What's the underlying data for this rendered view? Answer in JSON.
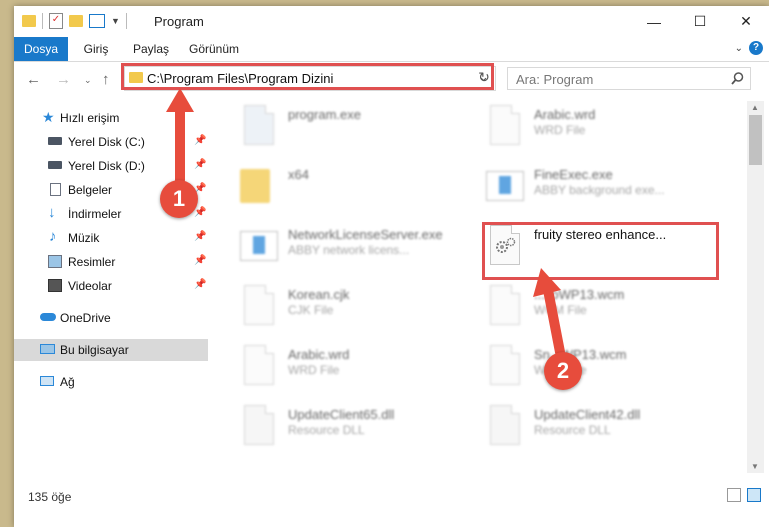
{
  "window": {
    "title": "Program"
  },
  "window_buttons": {
    "minimize": "—",
    "maximize": "☐",
    "close": "✕"
  },
  "ribbon": {
    "tabs": [
      "Dosya",
      "Giriş",
      "Paylaş",
      "Görünüm"
    ],
    "help": "?"
  },
  "address": {
    "path": "C:\\Program Files\\Program Dizini",
    "refresh": "↻",
    "dropdown": "⌄"
  },
  "search": {
    "placeholder": "Ara: Program",
    "icon": "search-icon"
  },
  "sidebar": {
    "items": [
      {
        "label": "Hızlı erişim",
        "icon": "star-icon",
        "pinned": false
      },
      {
        "label": "Yerel Disk (C:)",
        "icon": "drive-icon",
        "pinned": true
      },
      {
        "label": "Yerel Disk (D:)",
        "icon": "drive-icon",
        "pinned": true
      },
      {
        "label": "Belgeler",
        "icon": "documents-icon",
        "pinned": true
      },
      {
        "label": "İndirmeler",
        "icon": "download-icon",
        "pinned": true
      },
      {
        "label": "Müzik",
        "icon": "music-icon",
        "pinned": true
      },
      {
        "label": "Resimler",
        "icon": "pictures-icon",
        "pinned": true
      },
      {
        "label": "Videolar",
        "icon": "video-icon",
        "pinned": true
      },
      {
        "label": "OneDrive",
        "icon": "cloud-icon",
        "pinned": false
      },
      {
        "label": "Bu bilgisayar",
        "icon": "computer-icon",
        "pinned": false
      },
      {
        "label": "Ağ",
        "icon": "network-icon",
        "pinned": false
      }
    ]
  },
  "files": [
    {
      "name": "program.exe",
      "desc": ""
    },
    {
      "name": "Arabic.wrd",
      "desc": "WRD File"
    },
    {
      "name": "x64",
      "desc": ""
    },
    {
      "name": "FineExec.exe",
      "desc": "ABBY background exe..."
    },
    {
      "name": "NetworkLicenseServer.exe",
      "desc": "ABBY network licens..."
    },
    {
      "name": "fruity stereo enhance...",
      "desc": ""
    },
    {
      "name": "Korean.cjk",
      "desc": "CJK File"
    },
    {
      "name": "...ToWP13.wcm",
      "desc": "WCM File"
    },
    {
      "name": "Arabic.wrd",
      "desc": "WRD File"
    },
    {
      "name": "Sn...WP13.wcm",
      "desc": "WCM File"
    },
    {
      "name": "UpdateClient65.dll",
      "desc": "Resource DLL"
    },
    {
      "name": "UpdateClient42.dll",
      "desc": "Resource DLL"
    }
  ],
  "status": {
    "count": "135 öğe"
  },
  "annotations": {
    "badge1": "1",
    "badge2": "2",
    "color": "#e74c3c"
  }
}
